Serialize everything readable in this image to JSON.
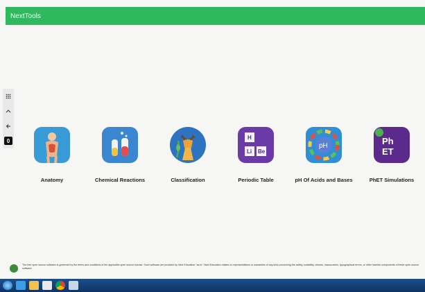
{
  "app": {
    "title": "NextTools"
  },
  "side_rail": {
    "items": [
      {
        "icon": "grid-icon"
      },
      {
        "icon": "chevron-up-icon"
      },
      {
        "icon": "back-arrow-icon"
      },
      {
        "icon": "zero-badge",
        "label": "0"
      }
    ]
  },
  "tiles": [
    {
      "label": "Anatomy",
      "icon": "anatomy-icon"
    },
    {
      "label": "Chemical Reactions",
      "icon": "chemistry-flask-icon"
    },
    {
      "label": "Classification",
      "icon": "deer-classification-icon"
    },
    {
      "label": "Periodic Table",
      "icon": "periodic-table-icon",
      "cells": [
        "H",
        "Li",
        "Be"
      ]
    },
    {
      "label": "pH Of Acids and Bases",
      "icon": "ph-scale-icon",
      "badge": "pH"
    },
    {
      "label": "PhET Simulations",
      "icon": "phet-icon",
      "badge": "PhET"
    }
  ],
  "footer": {
    "disclaimer": "The free open source software is governed by the terms and conditions of the applicable open source license. Such software are provided by Next Education \"as is\". Next Education makes no representations or warranties of any kind concerning the safety, suitability, viruses, inaccuracies, typographical errors, or other harmful components of these open source software."
  },
  "taskbar": {
    "items": [
      "start-orb-icon",
      "internet-explorer-icon",
      "folder-icon",
      "media-icon",
      "chrome-icon",
      "app-icon"
    ]
  },
  "colors": {
    "header": "#2fb85e",
    "background": "#f6f6f4",
    "taskbar": "#15427a"
  }
}
